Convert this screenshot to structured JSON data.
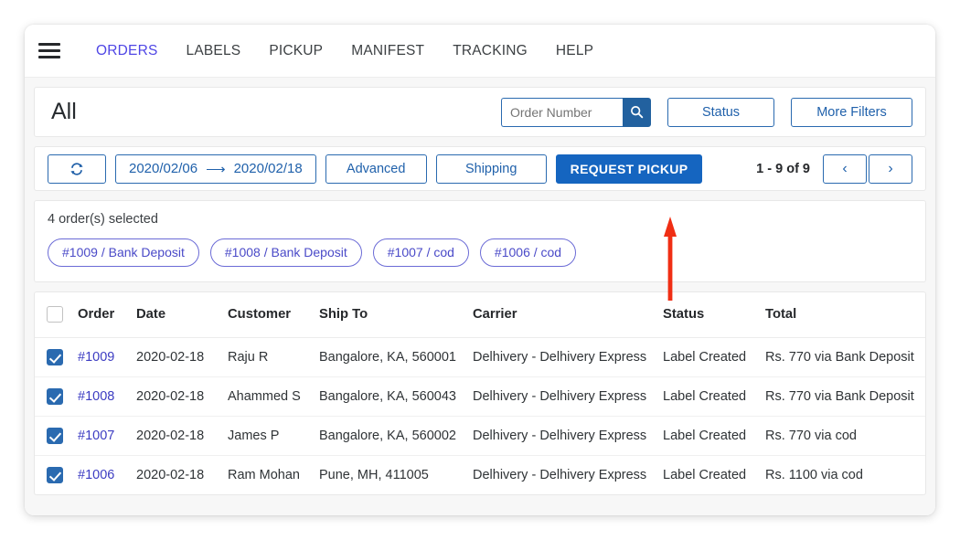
{
  "nav": {
    "menu_icon": "hamburger-icon",
    "items": [
      {
        "label": "ORDERS",
        "active": true
      },
      {
        "label": "LABELS",
        "active": false
      },
      {
        "label": "PICKUP",
        "active": false
      },
      {
        "label": "MANIFEST",
        "active": false
      },
      {
        "label": "TRACKING",
        "active": false
      },
      {
        "label": "HELP",
        "active": false
      }
    ]
  },
  "header": {
    "title": "All",
    "search": {
      "placeholder": "Order Number",
      "value": "",
      "button_icon": "search-icon"
    },
    "status_filter_label": "Status",
    "more_filters_label": "More Filters"
  },
  "toolbar": {
    "refresh_icon": "refresh-icon",
    "date_from": "2020/02/06",
    "date_arrow": "⟶",
    "date_to": "2020/02/18",
    "advanced_label": "Advanced",
    "shipping_label": "Shipping",
    "request_pickup_label": "REQUEST PICKUP",
    "pager_label": "1 - 9 of 9",
    "prev_icon": "‹",
    "next_icon": "›"
  },
  "selection": {
    "count_text": "4 order(s) selected",
    "chips": [
      "#1009 / Bank Deposit",
      "#1008 / Bank Deposit",
      "#1007 / cod",
      "#1006 / cod"
    ]
  },
  "table": {
    "columns": [
      "",
      "Order",
      "Date",
      "Customer",
      "Ship To",
      "Carrier",
      "Status",
      "Total"
    ],
    "header_checkbox_checked": false,
    "rows": [
      {
        "checked": true,
        "order": "#1009",
        "date": "2020-02-18",
        "customer": "Raju R",
        "ship_to": "Bangalore, KA, 560001",
        "carrier": "Delhivery - Delhivery Express",
        "status": "Label Created",
        "total": "Rs. 770 via Bank Deposit"
      },
      {
        "checked": true,
        "order": "#1008",
        "date": "2020-02-18",
        "customer": "Ahammed S",
        "ship_to": "Bangalore, KA, 560043",
        "carrier": "Delhivery - Delhivery Express",
        "status": "Label Created",
        "total": "Rs. 770 via Bank Deposit"
      },
      {
        "checked": true,
        "order": "#1007",
        "date": "2020-02-18",
        "customer": "James P",
        "ship_to": "Bangalore, KA, 560002",
        "carrier": "Delhivery - Delhivery Express",
        "status": "Label Created",
        "total": "Rs. 770 via cod"
      },
      {
        "checked": true,
        "order": "#1006",
        "date": "2020-02-18",
        "customer": "Ram Mohan",
        "ship_to": "Pune, MH, 411005",
        "carrier": "Delhivery - Delhivery Express",
        "status": "Label Created",
        "total": "Rs. 1100 via cod"
      }
    ]
  },
  "annotation": {
    "arrow_icon": "up-arrow-annotation",
    "color": "#f02e14",
    "points_to": "REQUEST PICKUP"
  },
  "colors": {
    "primary_blue": "#1565c0",
    "link_blue": "#2061ab",
    "nav_active": "#4f46e5",
    "chip_purple": "#4a4ac8",
    "order_link": "#3c3cc2",
    "checkbox_blue": "#2a6ab0",
    "page_bg": "#f7f7f7"
  }
}
